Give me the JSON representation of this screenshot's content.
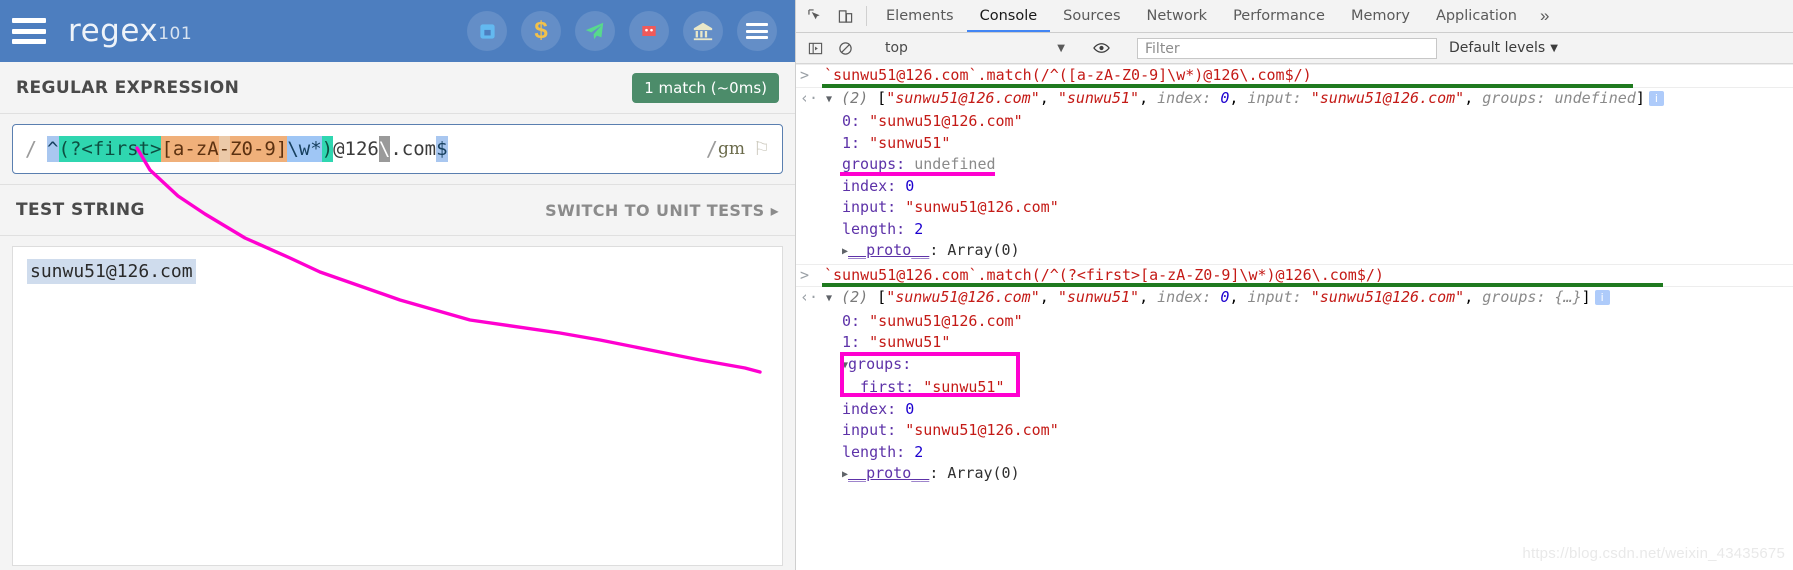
{
  "regex101": {
    "brand": "regex",
    "brand_sup": "101",
    "menu_icon": "hamburger-icon",
    "header_icons": [
      {
        "name": "twitter-icon",
        "glyph": "■"
      },
      {
        "name": "dollar-icon",
        "glyph": "$"
      },
      {
        "name": "telegram-send-icon",
        "glyph": "➤"
      },
      {
        "name": "github-cat-icon",
        "glyph": "●"
      },
      {
        "name": "bank-donate-icon",
        "glyph": "☷"
      },
      {
        "name": "menu-icon",
        "glyph": "☰"
      }
    ],
    "regex_section_title": "REGULAR EXPRESSION",
    "match_badge": "1 match (~0ms)",
    "regex_open_slash": "/",
    "regex_close_slash": "/",
    "flags": "gm",
    "flag_icon": "⚐",
    "regex_tokens": [
      {
        "text": "^",
        "cls": "tk-anchor"
      },
      {
        "text": "(?<first>",
        "cls": "tk-group"
      },
      {
        "text": "[a-zA",
        "cls": "tk-class"
      },
      {
        "text": "-",
        "cls": "tk-classsep"
      },
      {
        "text": "Z0-9]",
        "cls": "tk-class"
      },
      {
        "text": "\\w*",
        "cls": "tk-esc"
      },
      {
        "text": ")",
        "cls": "tk-group"
      },
      {
        "text": "@126",
        "cls": "tk-lit"
      },
      {
        "text": "\\",
        "cls": "tk-dot"
      },
      {
        "text": ".com",
        "cls": "tk-lit"
      },
      {
        "text": "$",
        "cls": "tk-end"
      }
    ],
    "regex_plain": "^(?<first>[a-zA-Z0-9]\\w*)@126\\.com$",
    "test_section_title": "TEST STRING",
    "unit_tests_link": "SWITCH TO UNIT TESTS ▸",
    "test_string": "sunwu51@126.com"
  },
  "devtools": {
    "inspect_icon": "inspect-element-icon",
    "device_icon": "device-toolbar-icon",
    "tabs": [
      {
        "label": "Elements",
        "active": false
      },
      {
        "label": "Console",
        "active": true
      },
      {
        "label": "Sources",
        "active": false
      },
      {
        "label": "Network",
        "active": false
      },
      {
        "label": "Performance",
        "active": false
      },
      {
        "label": "Memory",
        "active": false
      },
      {
        "label": "Application",
        "active": false
      }
    ],
    "more_tabs": "»",
    "toolbar": {
      "sidebar_toggle_icon": "console-sidebar-icon",
      "clear_icon": "clear-console-icon",
      "context": "top",
      "context_caret": "▼",
      "eye_icon": "live-expression-icon",
      "filter_placeholder": "Filter",
      "levels": "Default levels",
      "levels_caret": "▼"
    },
    "console": {
      "entries": [
        {
          "type": "command",
          "prompt": ">",
          "text": "`sunwu51@126.com`.match(/^([a-zA-Z0-9]\\w*)@126\\.com$/)",
          "annotation": "green-underline"
        },
        {
          "type": "result",
          "prompt": "<·",
          "summary_count": "(2)",
          "summary": "[\"sunwu51@126.com\", \"sunwu51\", index: 0, input: \"sunwu51@126.com\", groups: undefined]",
          "info_badge": "i",
          "props": [
            {
              "key": "0",
              "value": "\"sunwu51@126.com\"",
              "kind": "string"
            },
            {
              "key": "1",
              "value": "\"sunwu51\"",
              "kind": "string"
            },
            {
              "key": "groups",
              "value": "undefined",
              "kind": "undefined",
              "annotation": "magenta-underline"
            },
            {
              "key": "index",
              "value": "0",
              "kind": "number"
            },
            {
              "key": "input",
              "value": "\"sunwu51@126.com\"",
              "kind": "string"
            },
            {
              "key": "length",
              "value": "2",
              "kind": "number"
            },
            {
              "key": "__proto__",
              "value": "Array(0)",
              "kind": "proto"
            }
          ]
        },
        {
          "type": "command",
          "prompt": ">",
          "text": "`sunwu51@126.com`.match(/^(?<first>[a-zA-Z0-9]\\w*)@126\\.com$/)",
          "annotation": "green-underline"
        },
        {
          "type": "result",
          "prompt": "<·",
          "summary_count": "(2)",
          "summary": "[\"sunwu51@126.com\", \"sunwu51\", index: 0, input: \"sunwu51@126.com\", groups: {…}]",
          "info_badge": "i",
          "props": [
            {
              "key": "0",
              "value": "\"sunwu51@126.com\"",
              "kind": "string"
            },
            {
              "key": "1",
              "value": "\"sunwu51\"",
              "kind": "string"
            },
            {
              "key": "groups",
              "value": "",
              "kind": "expanded",
              "annotation": "magenta-box"
            },
            {
              "key": "first",
              "value": "\"sunwu51\"",
              "kind": "string",
              "nested": true
            },
            {
              "key": "index",
              "value": "0",
              "kind": "number"
            },
            {
              "key": "input",
              "value": "\"sunwu51@126.com\"",
              "kind": "string"
            },
            {
              "key": "length",
              "value": "2",
              "kind": "number"
            },
            {
              "key": "__proto__",
              "value": "Array(0)",
              "kind": "proto"
            }
          ]
        }
      ]
    }
  },
  "watermark": "https://blog.csdn.net/weixin_43435675",
  "colors": {
    "regex101_header": "#4d7ebf",
    "match_badge": "#4c8c6a",
    "annotation_magenta": "#ff00d0",
    "annotation_green": "#1f7a1f",
    "devtools_active_tab": "#4285f4"
  }
}
